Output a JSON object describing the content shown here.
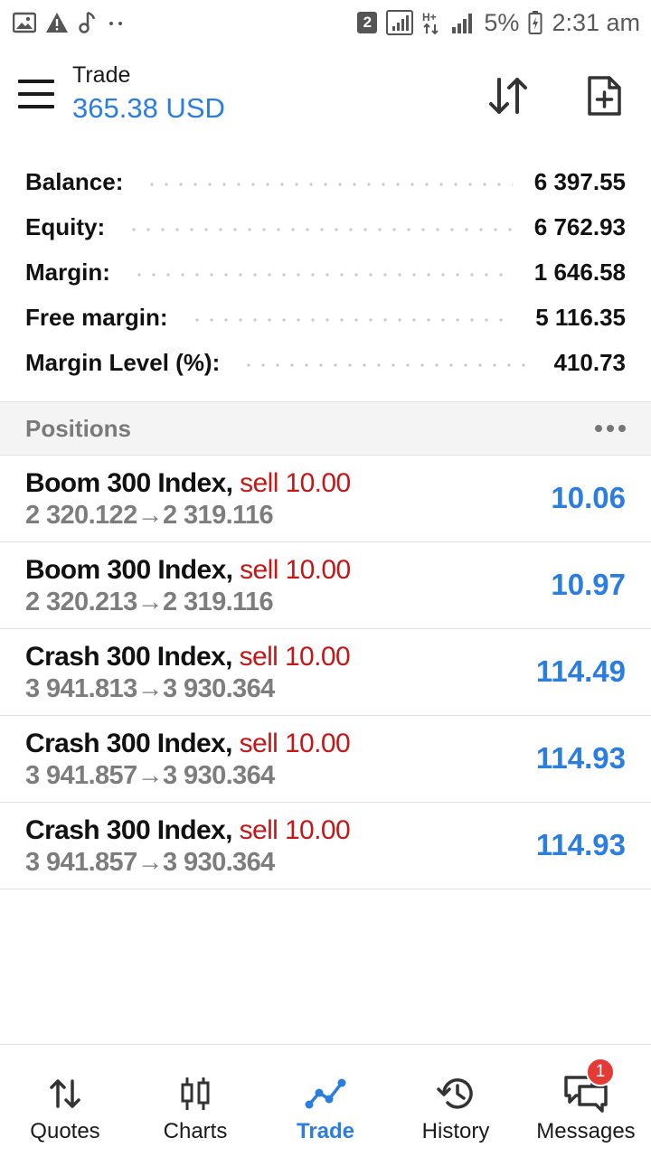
{
  "status_bar": {
    "sim_slot": "2",
    "network": "H+",
    "battery": "5%",
    "time": "2:31 am"
  },
  "header": {
    "title": "Trade",
    "subtitle": "365.38 USD"
  },
  "summary": [
    {
      "label": "Balance:",
      "value": "6 397.55"
    },
    {
      "label": "Equity:",
      "value": "6 762.93"
    },
    {
      "label": "Margin:",
      "value": "1 646.58"
    },
    {
      "label": "Free margin:",
      "value": "5 116.35"
    },
    {
      "label": "Margin Level (%):",
      "value": "410.73"
    }
  ],
  "positions_section": {
    "title": "Positions"
  },
  "positions": [
    {
      "symbol": "Boom 300 Index,",
      "side": "sell 10.00",
      "open_price": "2 320.122",
      "arrow": "→",
      "current_price": "2 319.116",
      "profit": "10.06"
    },
    {
      "symbol": "Boom 300 Index,",
      "side": "sell 10.00",
      "open_price": "2 320.213",
      "arrow": "→",
      "current_price": "2 319.116",
      "profit": "10.97"
    },
    {
      "symbol": "Crash 300 Index,",
      "side": "sell 10.00",
      "open_price": "3 941.813",
      "arrow": "→",
      "current_price": "3 930.364",
      "profit": "114.49"
    },
    {
      "symbol": "Crash 300 Index,",
      "side": "sell 10.00",
      "open_price": "3 941.857",
      "arrow": "→",
      "current_price": "3 930.364",
      "profit": "114.93"
    },
    {
      "symbol": "Crash 300 Index,",
      "side": "sell 10.00",
      "open_price": "3 941.857",
      "arrow": "→",
      "current_price": "3 930.364",
      "profit": "114.93"
    }
  ],
  "bottom_nav": [
    {
      "label": "Quotes",
      "icon": "quotes-icon",
      "active": false
    },
    {
      "label": "Charts",
      "icon": "charts-icon",
      "active": false
    },
    {
      "label": "Trade",
      "icon": "trade-icon",
      "active": true
    },
    {
      "label": "History",
      "icon": "history-icon",
      "active": false
    },
    {
      "label": "Messages",
      "icon": "messages-icon",
      "active": false,
      "badge": "1"
    }
  ],
  "colors": {
    "accent": "#2b7de0",
    "sell": "#c41818",
    "badge": "#e53935"
  }
}
